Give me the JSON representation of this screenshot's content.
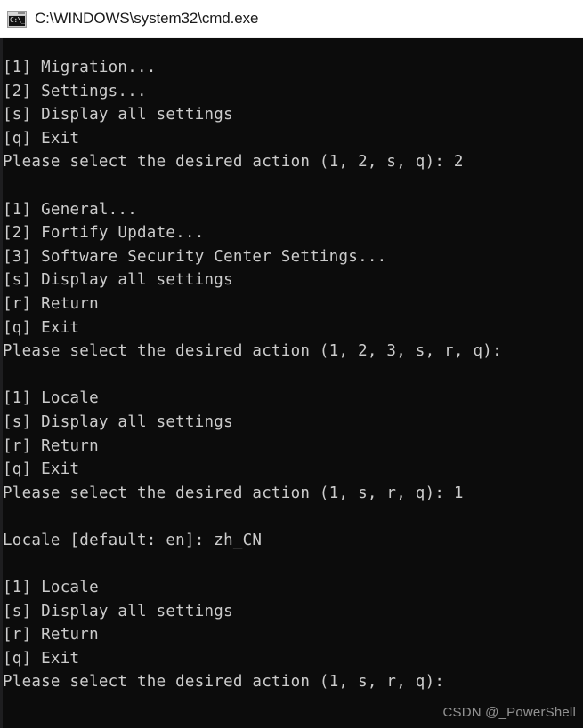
{
  "window": {
    "title": "C:\\WINDOWS\\system32\\cmd.exe",
    "icon": "cmd-console-icon",
    "icon_glyph": "C:\\_",
    "titlebar_bg": "#ffffff",
    "titlebar_fg": "#1b1b1b",
    "console_bg": "#0c0c0c",
    "console_fg": "#cccccc"
  },
  "console": {
    "lines": [
      "[1] Migration...",
      "[2] Settings...",
      "[s] Display all settings",
      "[q] Exit",
      "Please select the desired action (1, 2, s, q): 2",
      "",
      "[1] General...",
      "[2] Fortify Update...",
      "[3] Software Security Center Settings...",
      "[s] Display all settings",
      "[r] Return",
      "[q] Exit",
      "Please select the desired action (1, 2, 3, s, r, q):",
      "",
      "[1] Locale",
      "[s] Display all settings",
      "[r] Return",
      "[q] Exit",
      "Please select the desired action (1, s, r, q): 1",
      "",
      "Locale [default: en]: zh_CN",
      "",
      "[1] Locale",
      "[s] Display all settings",
      "[r] Return",
      "[q] Exit",
      "Please select the desired action (1, s, r, q):"
    ]
  },
  "watermark": {
    "text": "CSDN @_PowerShell"
  }
}
